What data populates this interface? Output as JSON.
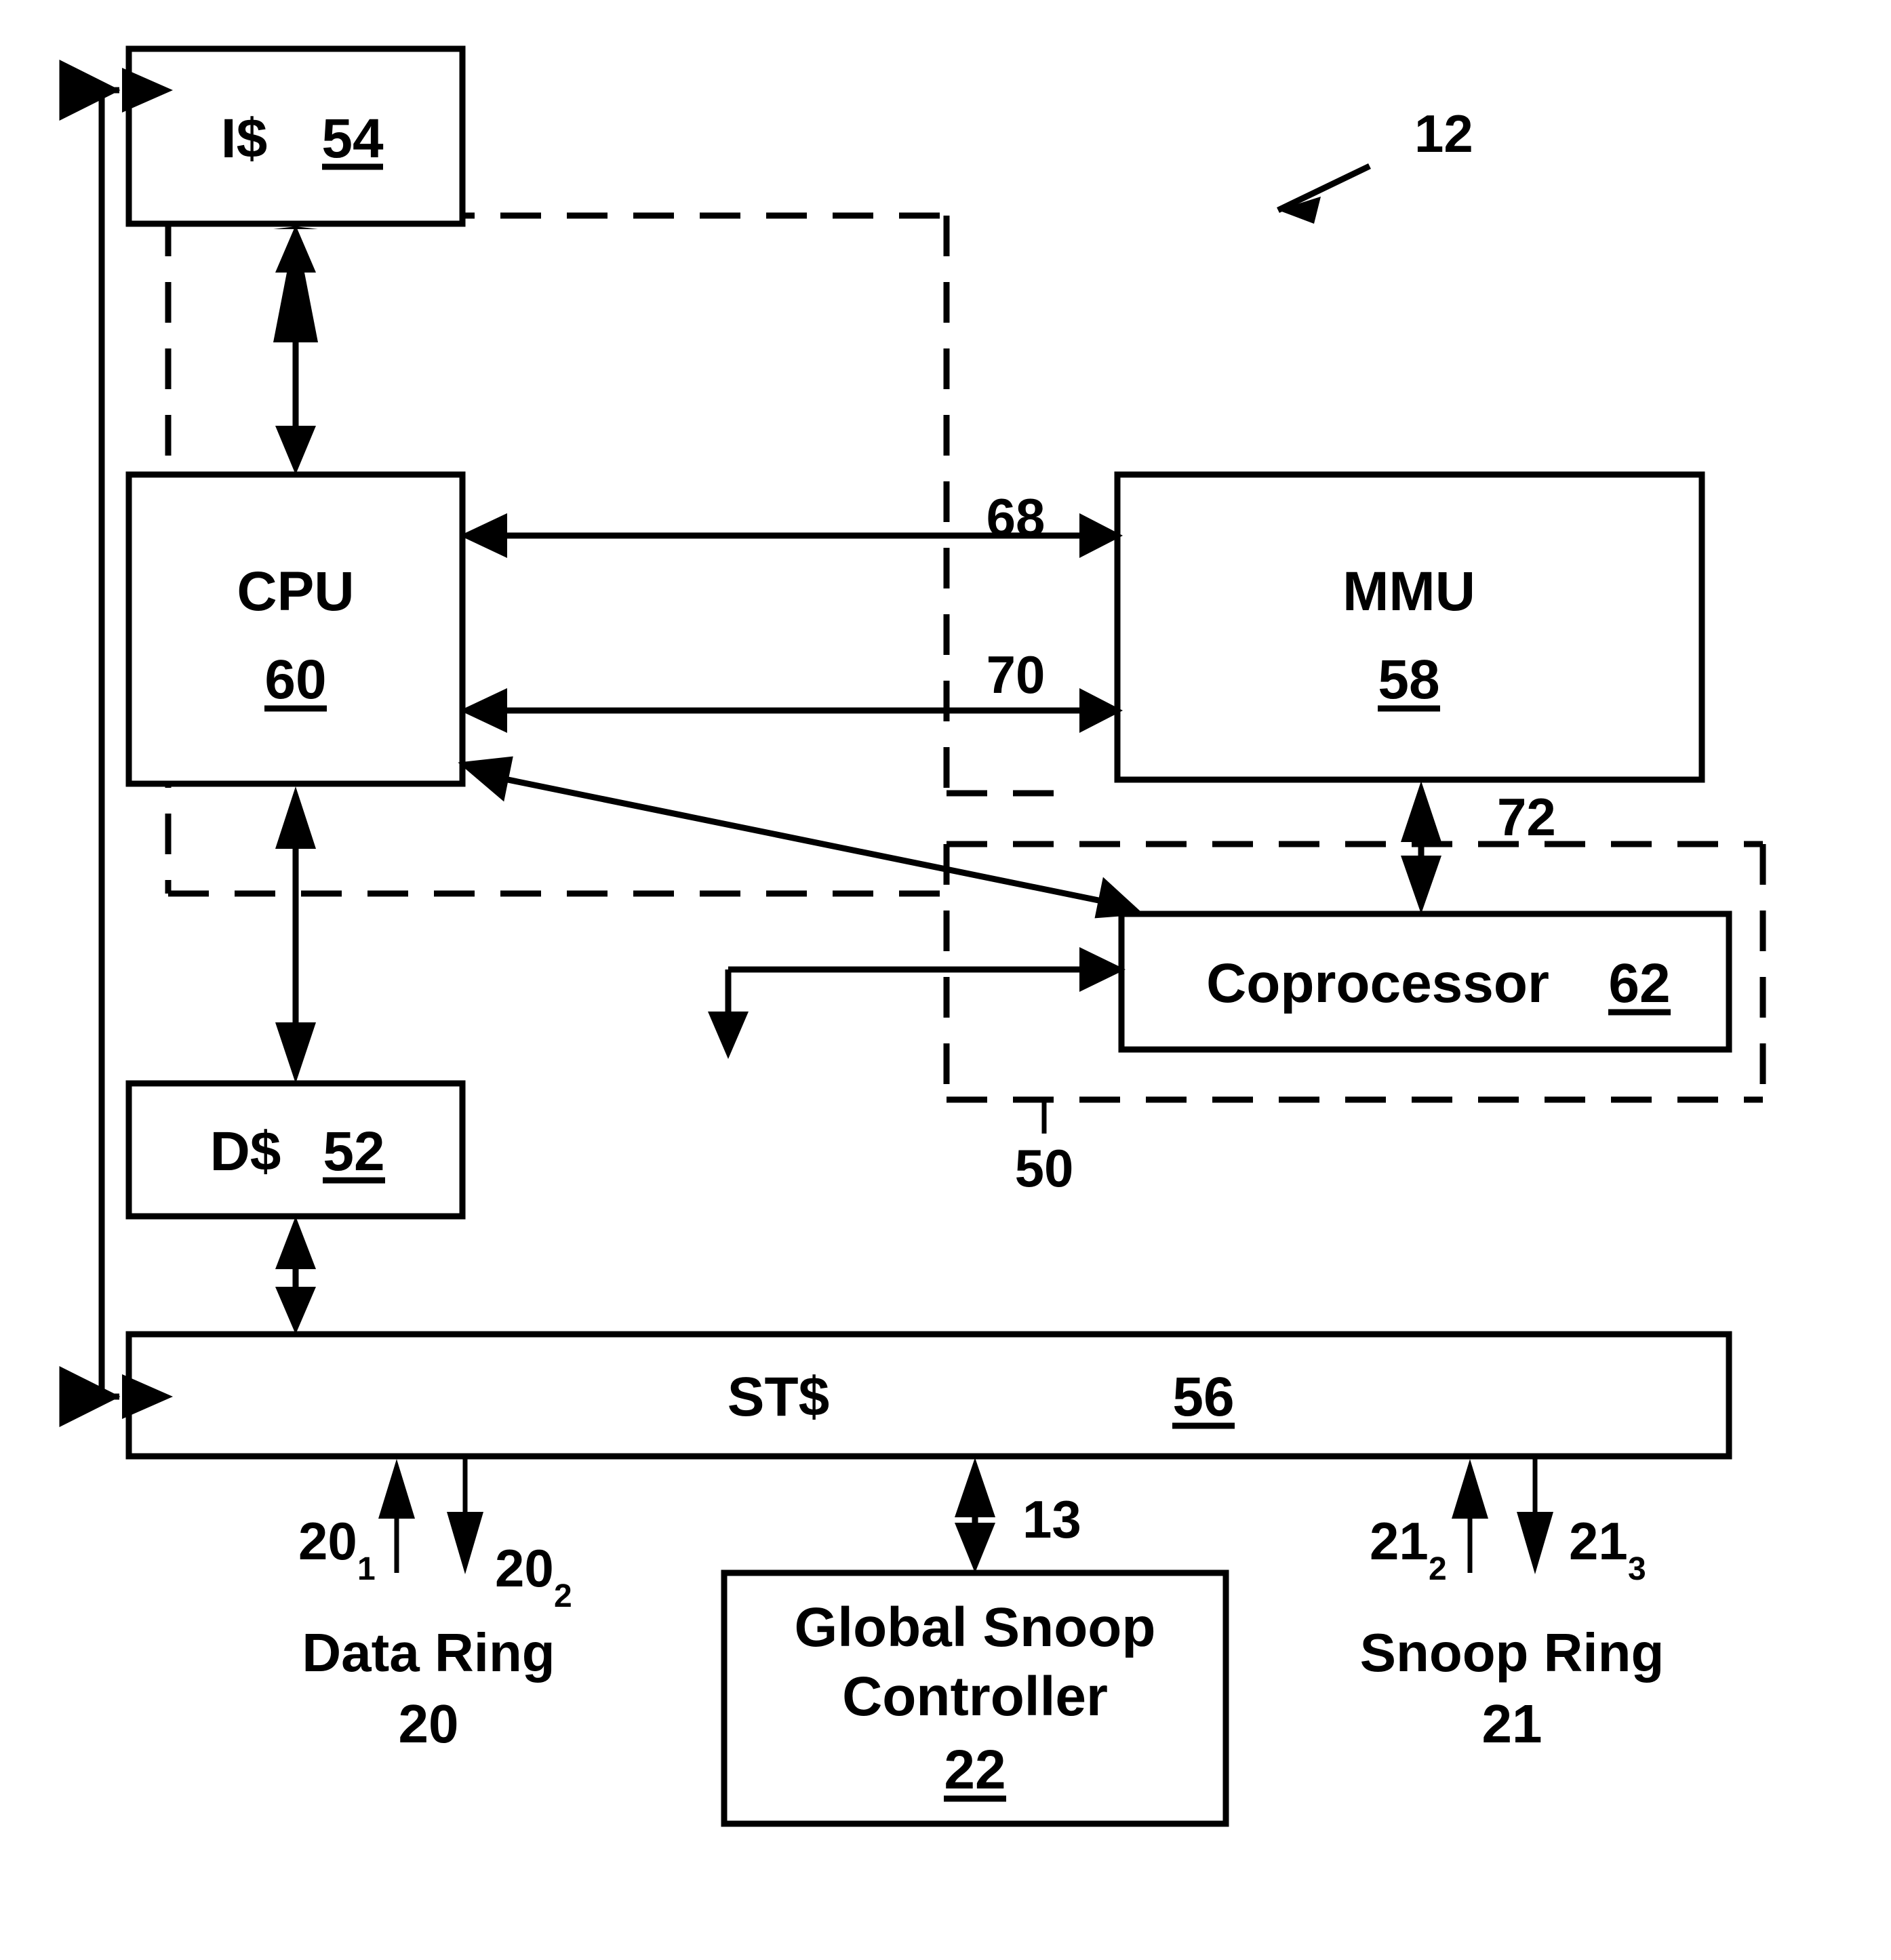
{
  "figure": {
    "reference_numeral": "12",
    "blocks": [
      {
        "id": "icache",
        "label": "I$",
        "ref": "54"
      },
      {
        "id": "cpu",
        "label": "CPU",
        "ref": "60"
      },
      {
        "id": "mmu",
        "label": "MMU",
        "ref": "58"
      },
      {
        "id": "coprocessor",
        "label": "Coprocessor",
        "ref": "62"
      },
      {
        "id": "dcache",
        "label": "D$",
        "ref": "52"
      },
      {
        "id": "stcache",
        "label": "ST$",
        "ref": "56"
      },
      {
        "id": "gsc",
        "label_line1": "Global Snoop",
        "label_line2": "Controller",
        "ref": "22"
      }
    ],
    "connection_labels": {
      "cpu_mmu_upper": "68",
      "cpu_mmu_lower": "70",
      "mmu_coprocessor": "72",
      "stcache_gsc": "13"
    },
    "region_labels": {
      "core_region": "50"
    },
    "buses": {
      "data_ring": {
        "name": "Data Ring",
        "ref": "20",
        "in_label_base": "20",
        "in_label_sub": "1",
        "out_label_base": "20",
        "out_label_sub": "2"
      },
      "snoop_ring": {
        "name": "Snoop Ring",
        "ref": "21",
        "in_label_base": "21",
        "in_label_sub": "2",
        "out_label_base": "21",
        "out_label_sub": "3"
      }
    },
    "colors": {
      "line": "#000000",
      "background": "#ffffff"
    }
  }
}
